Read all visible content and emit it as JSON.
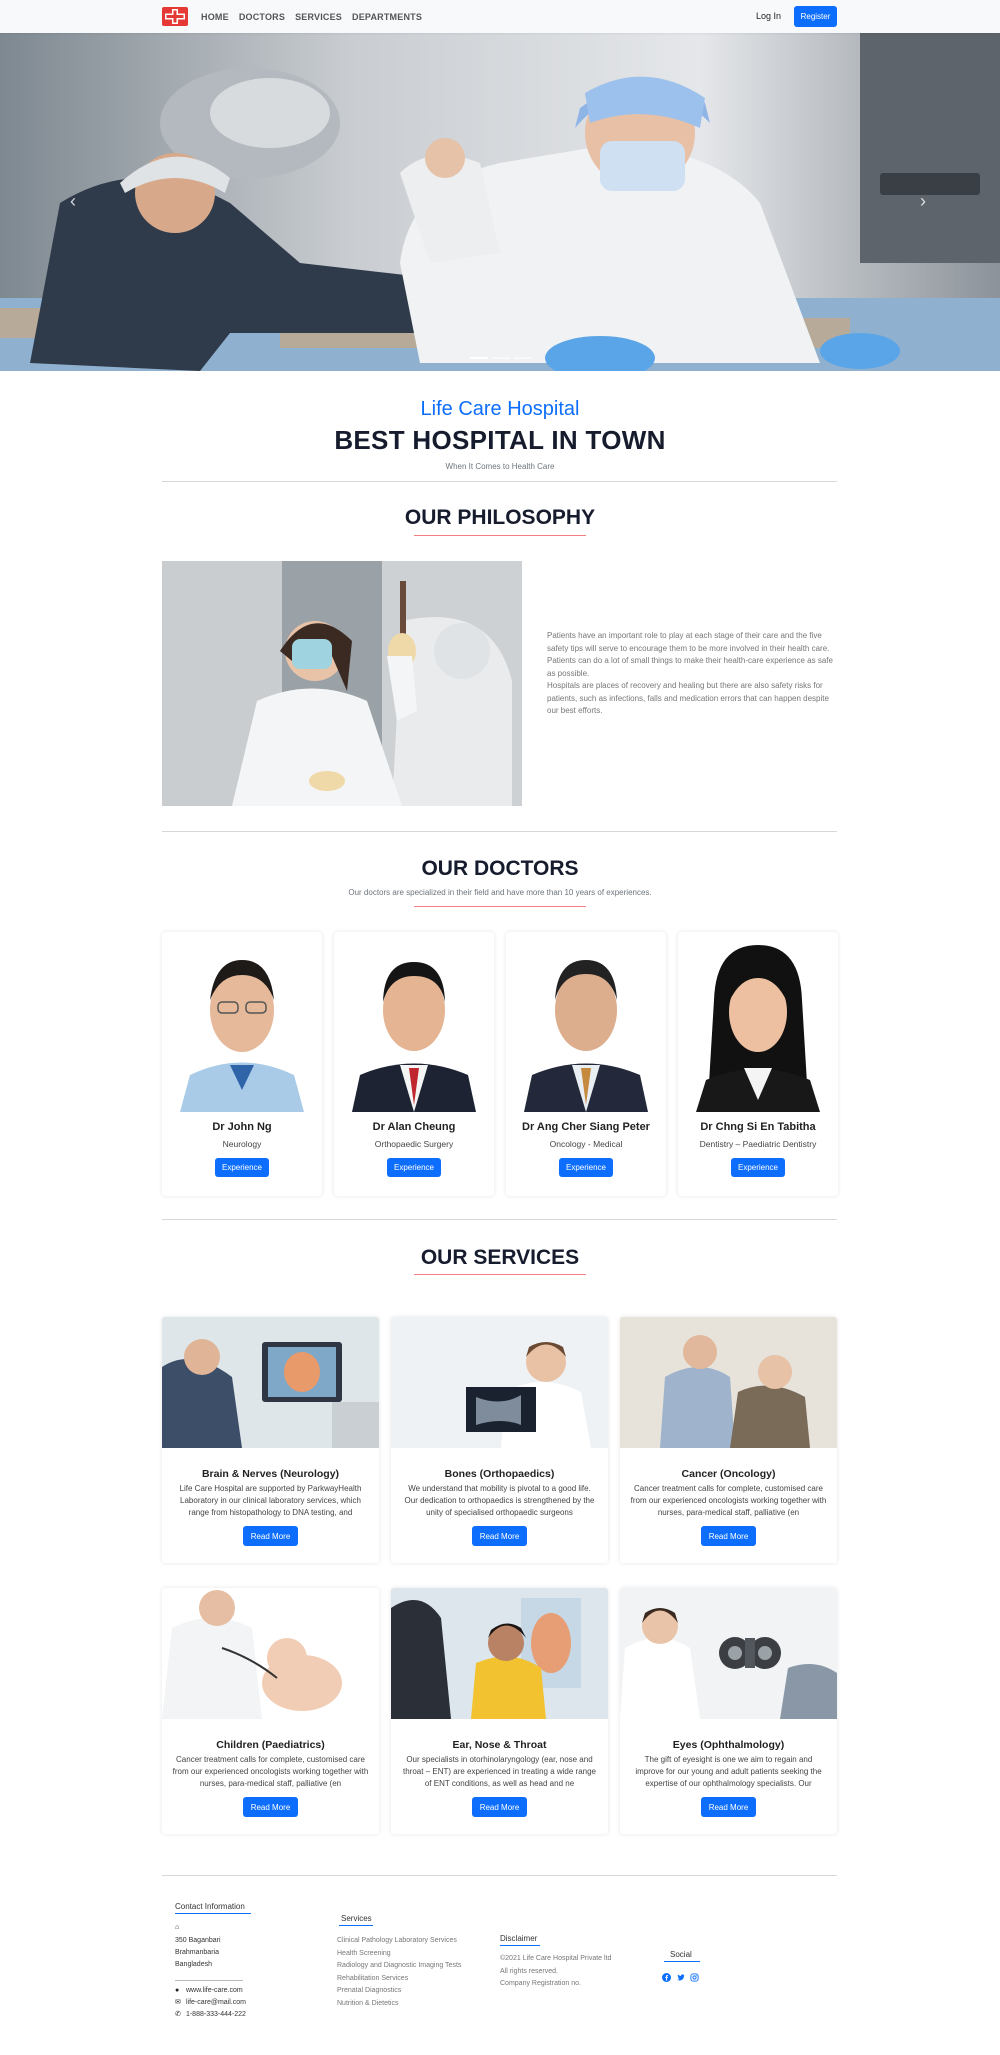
{
  "nav": {
    "items": [
      "HOME",
      "DOCTORS",
      "SERVICES",
      "DEPARTMENTS"
    ],
    "login": "Log In",
    "register": "Register"
  },
  "intro": {
    "name": "Life Care Hospital",
    "tagline": "BEST HOSPITAL IN TOWN",
    "sub": "When It Comes to Health Care"
  },
  "philosophy": {
    "title": "OUR PHILOSOPHY",
    "p1": "Patients have an important role to play at each stage of their care and the five safety tips will serve to encourage them to be more involved in their health care.",
    "p2": "Patients can do a lot of small things to make their health-care experience as safe as possible.",
    "p3": "Hospitals are places of recovery and healing but there are also safety risks for patients, such as infections, falls and medication errors that can happen despite our best efforts."
  },
  "doctors": {
    "title": "OUR DOCTORS",
    "sub": "Our doctors are specialized in their field and have more than 10 years of experiences.",
    "button": "Experience",
    "items": [
      {
        "name": "Dr John Ng",
        "spec": "Neurology"
      },
      {
        "name": "Dr Alan Cheung",
        "spec": "Orthopaedic Surgery"
      },
      {
        "name": "Dr Ang Cher Siang Peter",
        "spec": "Oncology - Medical"
      },
      {
        "name": "Dr Chng Si En Tabitha",
        "spec": "Dentistry – Paediatric Dentistry"
      }
    ]
  },
  "services": {
    "title": "OUR SERVICES",
    "button": "Read More",
    "items": [
      {
        "title": "Brain & Nerves (Neurology)",
        "desc": "Life Care Hospital are supported by ParkwayHealth Laboratory in our clinical laboratory services, which range from histopathology to DNA testing, and"
      },
      {
        "title": "Bones (Orthopaedics)",
        "desc": "We understand that mobility is pivotal to a good life. Our dedication to orthopaedics is strengthened by the unity of specialised orthopaedic surgeons"
      },
      {
        "title": "Cancer (Oncology)",
        "desc": "Cancer treatment calls for complete, customised care from our experienced oncologists working together with nurses, para-medical staff, palliative (en"
      },
      {
        "title": "Children (Paediatrics)",
        "desc": "Cancer treatment calls for complete, customised care from our experienced oncologists working together with nurses, para-medical staff, palliative (en"
      },
      {
        "title": "Ear, Nose & Throat",
        "desc": "Our specialists in otorhinolaryngology (ear, nose and throat – ENT) are experienced in treating a wide range of ENT conditions, as well as head and ne"
      },
      {
        "title": "Eyes (Ophthalmology)",
        "desc": "The gift of eyesight is one we aim to regain and improve for our young and adult patients seeking the expertise of our ophthalmology specialists. Our"
      }
    ]
  },
  "footer": {
    "contact_title": "Contact Information",
    "address": [
      "350 Baganbari",
      "Brahmanbaria",
      "Bangladesh"
    ],
    "website": "www.life-care.com",
    "email": "life-care@mail.com",
    "phone": "1-888-333-444-222",
    "services_title": "Services",
    "services": [
      "Clinical Pathology Laboratory Services",
      "Health Screening",
      "Radiology and Diagnostic Imaging Tests",
      "Rehabilitation Services",
      "Prenatal Diagnostics",
      "Nutrition & Dietetics"
    ],
    "disclaimer_title": "Disclaimer",
    "disclaimer": [
      "©2021 Life Care Hospital Private ltd",
      "All rights reserved.",
      "Company Registration no."
    ],
    "social_title": "Social",
    "social_icons": [
      "facebook-icon",
      "twitter-icon",
      "instagram-icon"
    ]
  },
  "colors": {
    "accent": "#0d6efd",
    "heading": "#161c2d",
    "underline": "#f08080"
  }
}
